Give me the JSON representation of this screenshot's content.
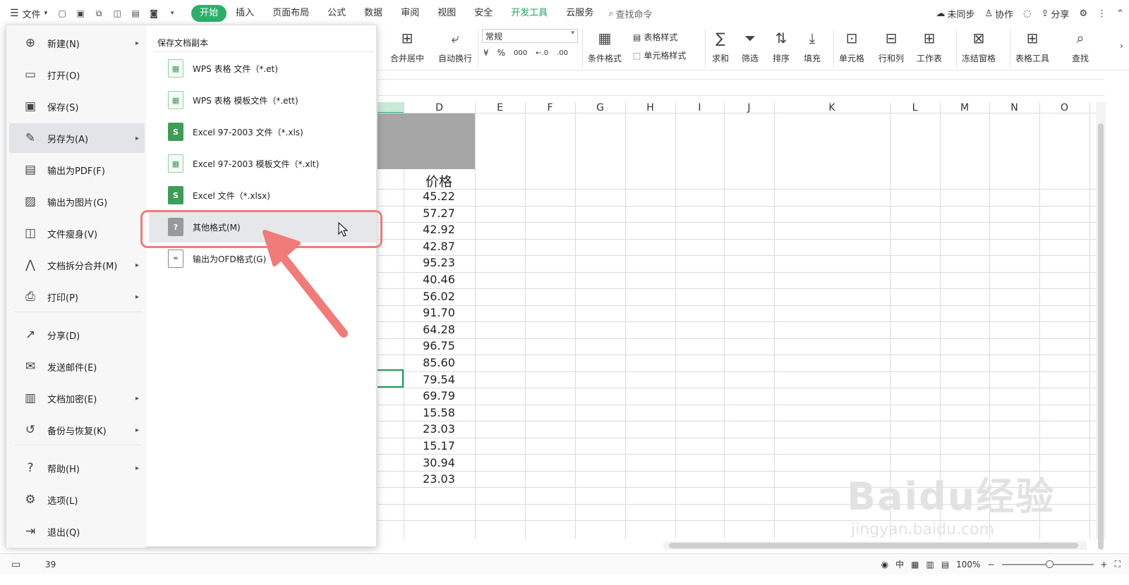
{
  "topbar": {
    "file_label": "文件",
    "tabs": [
      "开始",
      "插入",
      "页面布局",
      "公式",
      "数据",
      "审阅",
      "视图",
      "安全",
      "开发工具",
      "云服务"
    ],
    "search_placeholder": "查找命令",
    "sync_label": "未同步",
    "collab_label": "协作",
    "share_label": "分享"
  },
  "ribbon": {
    "merge_label": "合并居中",
    "wrap_label": "自动换行",
    "number_format": "常规",
    "currency_symbol": "¥",
    "percent_symbol": "%",
    "thousands_symbol": "000",
    "cond_format_label": "条件格式",
    "table_style_label": "表格样式",
    "cell_style_label": "单元格样式",
    "sum_label": "求和",
    "filter_label": "筛选",
    "sort_label": "排序",
    "fill_label": "填充",
    "cell_label": "单元格",
    "rowcol_label": "行和列",
    "sheet_label": "工作表",
    "freeze_label": "冻结窗格",
    "tools_label": "表格工具",
    "find_label": "查找"
  },
  "columns": [
    "D",
    "E",
    "F",
    "G",
    "H",
    "I",
    "J",
    "K",
    "L",
    "M",
    "N",
    "O"
  ],
  "sheet": {
    "header": "价格",
    "prices": [
      "45.22",
      "57.27",
      "42.92",
      "42.87",
      "95.23",
      "40.46",
      "56.02",
      "91.70",
      "64.28",
      "96.75",
      "85.60",
      "79.54",
      "69.79",
      "15.58",
      "23.03",
      "15.17",
      "30.94",
      "23.03"
    ]
  },
  "file_menu": {
    "items": [
      {
        "label": "新建(N)",
        "icon": "new-file-icon",
        "arrow": true
      },
      {
        "label": "打开(O)",
        "icon": "folder-icon",
        "arrow": false
      },
      {
        "label": "保存(S)",
        "icon": "save-icon",
        "arrow": false
      },
      {
        "label": "另存为(A)",
        "icon": "save-as-icon",
        "arrow": true
      },
      {
        "label": "输出为PDF(F)",
        "icon": "pdf-icon",
        "arrow": false
      },
      {
        "label": "输出为图片(G)",
        "icon": "image-icon",
        "arrow": false
      },
      {
        "label": "文件瘦身(V)",
        "icon": "slim-icon",
        "arrow": false
      },
      {
        "label": "文档拆分合并(M)",
        "icon": "split-merge-icon",
        "arrow": true
      },
      {
        "label": "打印(P)",
        "icon": "print-icon",
        "arrow": true
      },
      {
        "label": "分享(D)",
        "icon": "share-icon",
        "arrow": false
      },
      {
        "label": "发送邮件(E)",
        "icon": "mail-icon",
        "arrow": false
      },
      {
        "label": "文档加密(E)",
        "icon": "encrypt-icon",
        "arrow": true
      },
      {
        "label": "备份与恢复(K)",
        "icon": "backup-icon",
        "arrow": true
      },
      {
        "label": "帮助(H)",
        "icon": "help-icon",
        "arrow": true
      },
      {
        "label": "选项(L)",
        "icon": "settings-icon",
        "arrow": false
      },
      {
        "label": "退出(Q)",
        "icon": "exit-icon",
        "arrow": false
      }
    ]
  },
  "save_copy": {
    "title": "保存文档副本",
    "items": [
      {
        "label": "WPS 表格 文件（*.et)",
        "kind": "et"
      },
      {
        "label": "WPS 表格 模板文件（*.ett)",
        "kind": "et"
      },
      {
        "label": "Excel 97-2003 文件（*.xls)",
        "kind": "xl"
      },
      {
        "label": "Excel 97-2003 模板文件（*.xlt)",
        "kind": "et"
      },
      {
        "label": "Excel 文件（*.xlsx)",
        "kind": "xl"
      },
      {
        "label": "其他格式(M)",
        "kind": "q"
      },
      {
        "label": "输出为OFD格式(G)",
        "kind": "ofd"
      }
    ]
  },
  "status": {
    "count": "39",
    "zoom": "100%"
  },
  "watermark": {
    "big": "Baidu经验",
    "small": "jingyan.baidu.com"
  },
  "colors": {
    "accent_green": "#2bb069",
    "highlight_red": "#f07b78"
  }
}
